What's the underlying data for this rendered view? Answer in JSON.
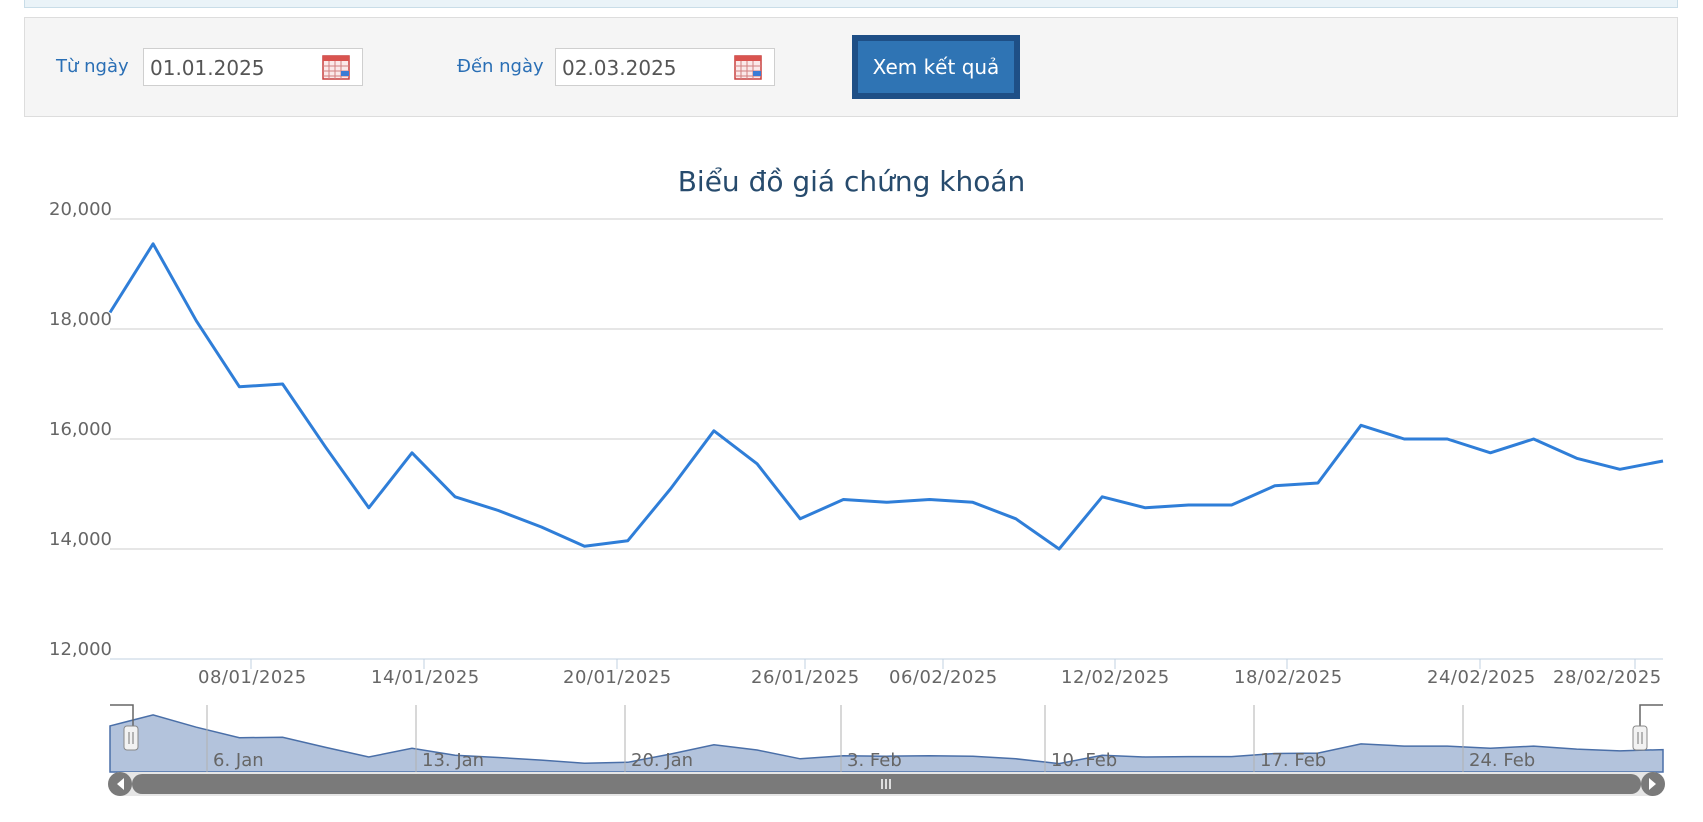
{
  "filter": {
    "from_label": "Từ ngày",
    "from_value": "01.01.2025",
    "to_label": "Đến ngày",
    "to_value": "02.03.2025",
    "submit_label": "Xem kết quả"
  },
  "colors": {
    "line": "#2f7ed8",
    "navigator_fill": "#b3c3dc",
    "navigator_line": "#4a6fa8",
    "label": "#2a6fb5",
    "button": "#2f74b4"
  },
  "chart_data": {
    "type": "line",
    "title": "Biểu đồ giá chứng khoán",
    "xlabel": "",
    "ylabel": "",
    "ylim": [
      12000,
      20000
    ],
    "yticks": [
      "20,000",
      "18,000",
      "16,000",
      "14,000",
      "12,000"
    ],
    "grid": true,
    "legend": "none",
    "x": [
      "02/01/2025",
      "03/01/2025",
      "06/01/2025",
      "07/01/2025",
      "08/01/2025",
      "09/01/2025",
      "10/01/2025",
      "13/01/2025",
      "14/01/2025",
      "15/01/2025",
      "16/01/2025",
      "17/01/2025",
      "20/01/2025",
      "21/01/2025",
      "22/01/2025",
      "23/01/2025",
      "24/01/2025",
      "26/01/2025",
      "27/01/2025",
      "03/02/2025",
      "04/02/2025",
      "05/02/2025",
      "06/02/2025",
      "07/02/2025",
      "10/02/2025",
      "11/02/2025",
      "12/02/2025",
      "13/02/2025",
      "14/02/2025",
      "17/02/2025",
      "18/02/2025",
      "19/02/2025",
      "20/02/2025",
      "21/02/2025",
      "24/02/2025",
      "25/02/2025",
      "26/02/2025",
      "27/02/2025",
      "28/02/2025"
    ],
    "values": [
      18300,
      19550,
      18150,
      16950,
      17000,
      15850,
      14750,
      15750,
      14950,
      14700,
      14400,
      14050,
      14150,
      15100,
      16150,
      15550,
      14550,
      14900,
      14850,
      14900,
      14850,
      14550,
      14000,
      14950,
      14750,
      14800,
      14800,
      15150,
      15200,
      16250,
      16000,
      16000,
      15750,
      16000,
      15650,
      15450,
      15600
    ],
    "series": [
      {
        "values": []
      }
    ],
    "x_tick_labels": [
      "08/01/2025",
      "14/01/2025",
      "20/01/2025",
      "26/01/2025",
      "06/02/2025",
      "12/02/2025",
      "18/02/2025",
      "24/02/2025",
      "28/02/2025"
    ],
    "navigator_tick_labels": [
      "6. Jan",
      "13. Jan",
      "20. Jan",
      "3. Feb",
      "10. Feb",
      "17. Feb",
      "24. Feb"
    ]
  }
}
